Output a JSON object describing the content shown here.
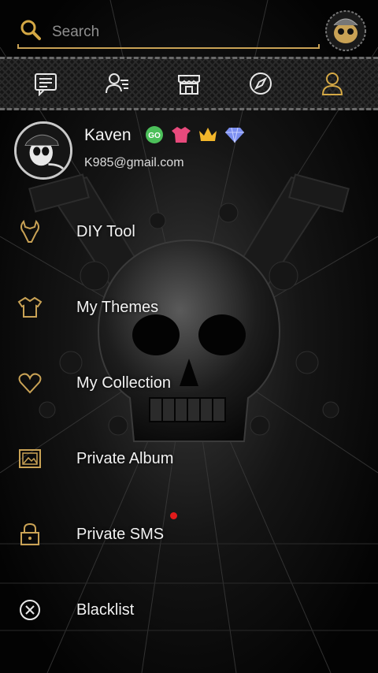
{
  "search": {
    "placeholder": "Search"
  },
  "toolbar": {
    "items": [
      {
        "icon": "message-icon"
      },
      {
        "icon": "contacts-icon"
      },
      {
        "icon": "store-icon"
      },
      {
        "icon": "compass-icon"
      },
      {
        "icon": "person-icon"
      }
    ]
  },
  "profile": {
    "name": "Kaven",
    "email": "K985@gmail.com",
    "badges": [
      {
        "icon": "go-badge-icon",
        "color": "#4cc05a"
      },
      {
        "icon": "tshirt-badge-icon",
        "color": "#e84a7c"
      },
      {
        "icon": "crown-badge-icon",
        "color": "#f2b62b"
      },
      {
        "icon": "diamond-badge-icon",
        "color": "#7b8ef0"
      }
    ]
  },
  "menu": {
    "items": [
      {
        "label": "DIY Tool",
        "icon": "wrench-icon"
      },
      {
        "label": "My Themes",
        "icon": "shirt-icon"
      },
      {
        "label": "My Collection",
        "icon": "heart-icon"
      },
      {
        "label": "Private Album",
        "icon": "album-icon"
      },
      {
        "label": "Private SMS",
        "icon": "lock-icon",
        "notification": true
      },
      {
        "label": "Blacklist",
        "icon": "block-icon"
      }
    ]
  },
  "colors": {
    "accent": "#c9a255",
    "notification": "#e21b1b",
    "background": "#050505"
  }
}
